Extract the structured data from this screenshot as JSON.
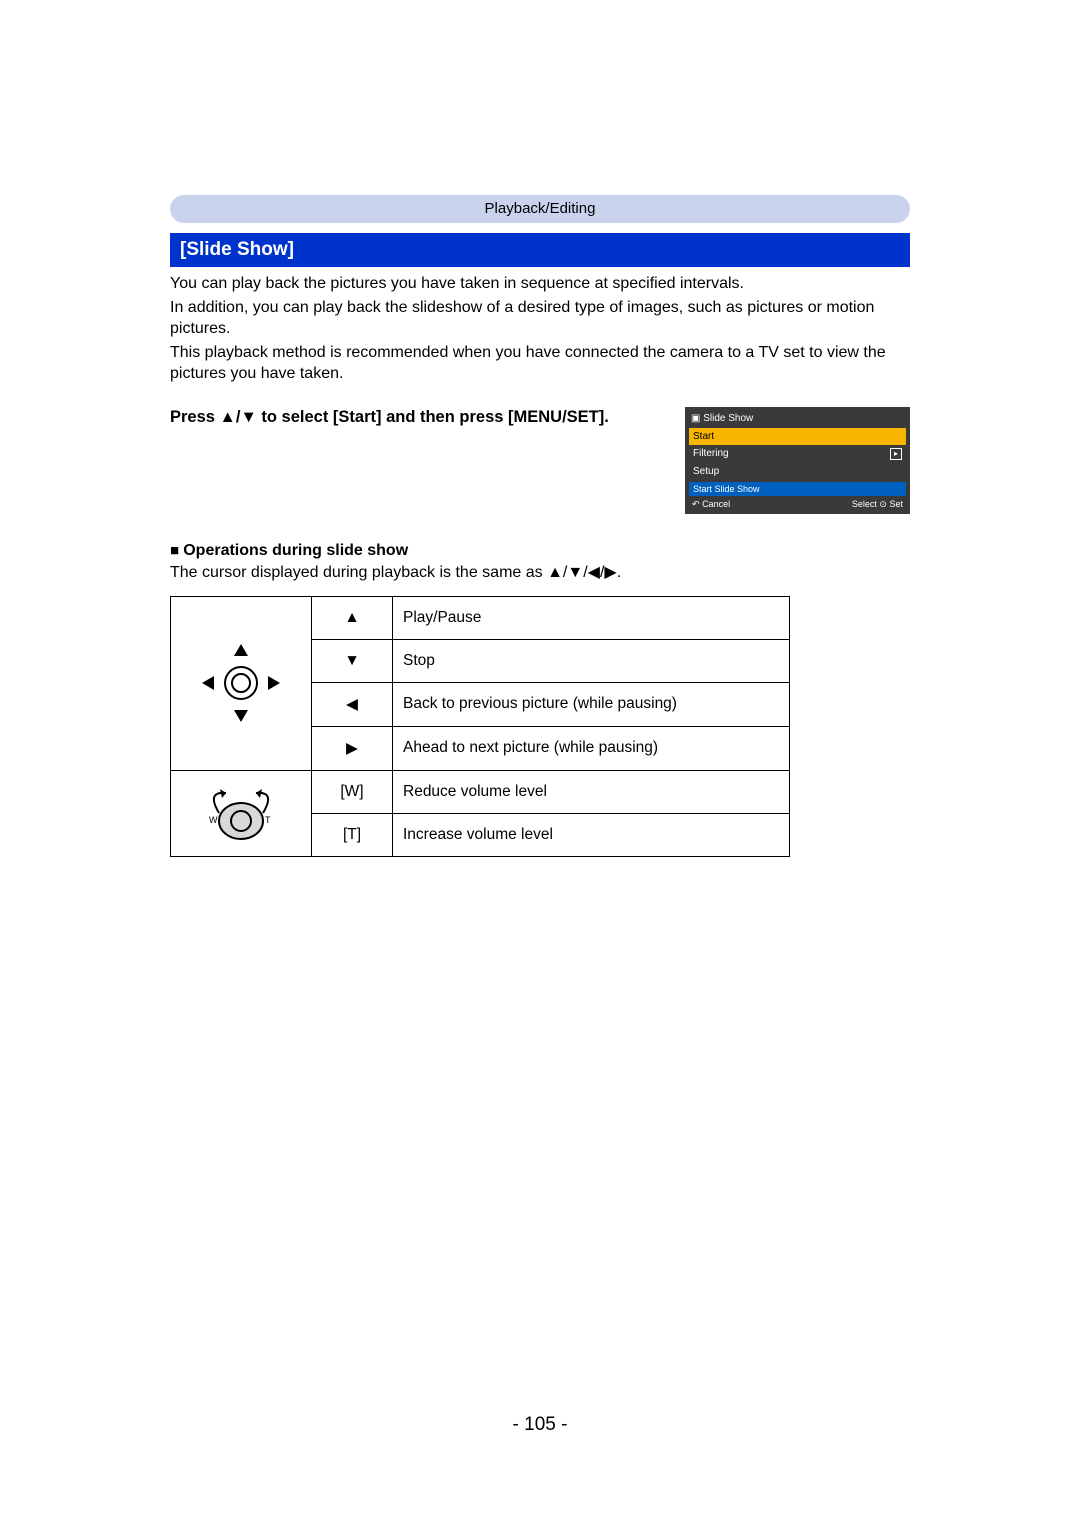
{
  "breadcrumb": "Playback/Editing",
  "section_title": "[Slide Show]",
  "paragraphs": [
    "You can play back the pictures you have taken in sequence at specified intervals.",
    "In addition, you can play back the slideshow of a desired type of images, such as pictures or motion pictures.",
    "This playback method is recommended when you have connected the camera to a TV set to view the pictures you have taken."
  ],
  "instruction": "Press ▲/▼ to select [Start] and then press [MENU/SET].",
  "menu": {
    "title": "Slide Show",
    "items": [
      {
        "label": "Start",
        "selected": true
      },
      {
        "label": "Filtering",
        "selected": false
      },
      {
        "label": "Setup",
        "selected": false
      }
    ],
    "status": "Start Slide Show",
    "footer_left": "Cancel",
    "footer_right_select": "Select",
    "footer_right_set": "Set",
    "play_icon": "▸"
  },
  "operations_heading": "Operations during slide show",
  "cursor_note_prefix": "The cursor displayed during playback is the same as ",
  "cursor_note_symbols": "▲/▼/◀/▶",
  "cursor_note_suffix": ".",
  "table": {
    "rows_dpad": [
      {
        "symbol": "▲",
        "desc": "Play/Pause"
      },
      {
        "symbol": "▼",
        "desc": "Stop"
      },
      {
        "symbol": "◀",
        "desc": "Back to previous picture (while pausing)"
      },
      {
        "symbol": "▶",
        "desc": "Ahead to next picture (while pausing)"
      }
    ],
    "rows_zoom": [
      {
        "symbol": "[W]",
        "desc": "Reduce volume level"
      },
      {
        "symbol": "[T]",
        "desc": "Increase volume level"
      }
    ]
  },
  "page_number": "- 105 -"
}
